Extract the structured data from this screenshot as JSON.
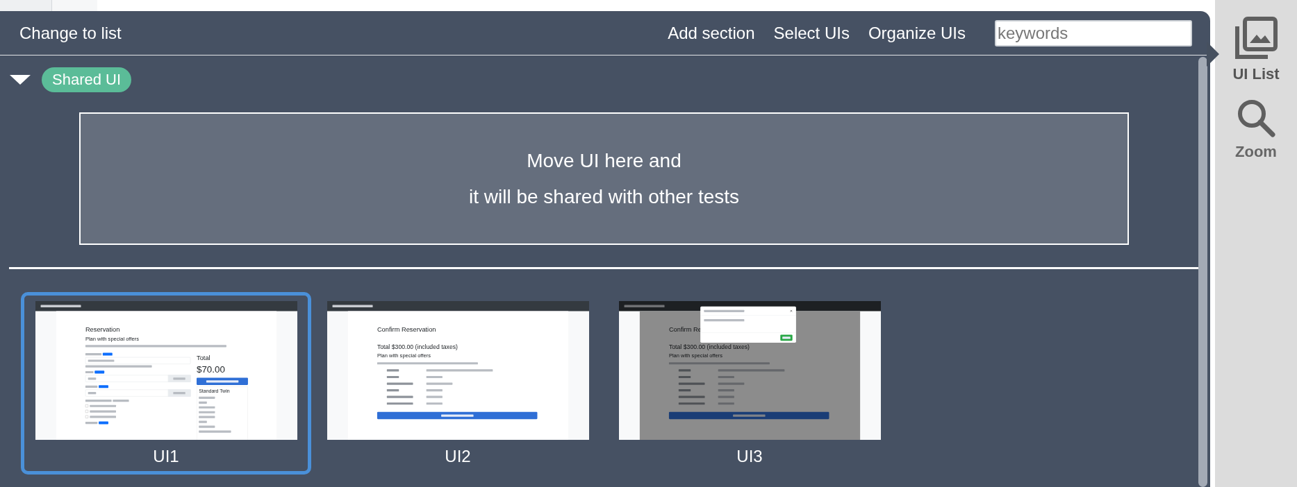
{
  "panel": {
    "view_toggle": "Change to list",
    "actions": [
      "Add section",
      "Select UIs",
      "Organize UIs"
    ],
    "search": {
      "placeholder": "keywords"
    },
    "sections": [
      {
        "name": "Shared UI",
        "expanded": true,
        "drop_hint": [
          "Move UI here and",
          "it will be shared with other tests"
        ]
      }
    ],
    "uis": [
      {
        "label": "UI1",
        "selected": true,
        "kind": "reservation",
        "title": "Reservation",
        "subtitle": "Plan with special offers",
        "plans": [
          {
            "checked": false
          },
          {
            "checked": false
          },
          {
            "checked": false
          }
        ],
        "total_label": "Total",
        "total": "$70.00",
        "room_title": "Standard Twin"
      },
      {
        "label": "UI2",
        "selected": false,
        "kind": "confirm",
        "title": "Confirm Reservation",
        "total": "Total $300.00 (included taxes)",
        "subtitle": "Plan with special offers",
        "dialog_shown": false
      },
      {
        "label": "UI3",
        "selected": false,
        "kind": "confirm",
        "title": "Confirm Re",
        "total": "Total $300.00 (included taxes)",
        "subtitle": "Plan with special offers",
        "dialog_shown": true
      }
    ]
  },
  "sidebar": {
    "items": [
      {
        "label": "UI List",
        "kind": "images",
        "selected": true
      },
      {
        "label": "Zoom",
        "kind": "search",
        "selected": false
      }
    ]
  }
}
